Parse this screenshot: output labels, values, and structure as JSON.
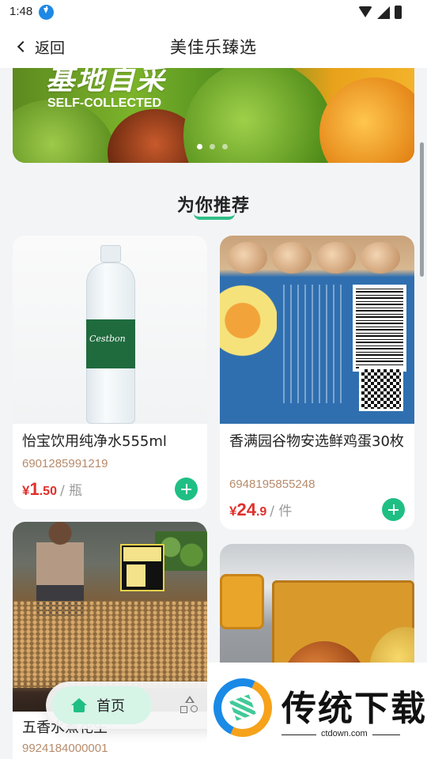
{
  "status_bar": {
    "time": "1:48",
    "icons": [
      "download-icon",
      "wifi-icon",
      "signal-icon",
      "battery-icon"
    ]
  },
  "header": {
    "back_label": "返回",
    "title": "美佳乐臻选"
  },
  "banner": {
    "headline": "基地自采",
    "subtitle": "SELF-COLLECTED",
    "slides": 3,
    "active_slide": 1
  },
  "section": {
    "title": "为你推荐"
  },
  "products": [
    {
      "name": "怡宝饮用纯净水555ml",
      "code": "6901285991219",
      "currency": "¥",
      "price_int": "1",
      "price_dec": ".50",
      "unit": "/ 瓶",
      "bottle_brand": "Cestbon"
    },
    {
      "name": "香满园谷物安选鲜鸡蛋30枚",
      "code": "6948195855248",
      "currency": "¥",
      "price_int": "24",
      "price_dec": ".9",
      "unit": "/ 件"
    },
    {
      "name": "五香水煮花生",
      "code": "9924184000001"
    },
    {
      "name": "",
      "code": ""
    }
  ],
  "tabbar": {
    "home_label": "首页",
    "category_icon": "category-icon"
  },
  "watermark": {
    "title": "传统下载",
    "url": "ctdown.com"
  },
  "colors": {
    "accent": "#1fbf84",
    "price": "#e0302c",
    "code": "#b78b6b"
  }
}
